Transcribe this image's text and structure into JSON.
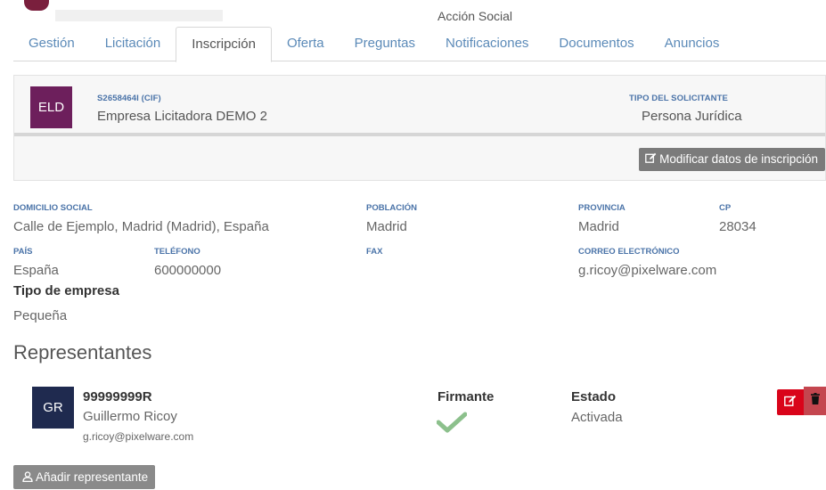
{
  "header": {
    "context_title": "Acción Social"
  },
  "tabs": [
    {
      "label": "Gestión",
      "active": false
    },
    {
      "label": "Licitación",
      "active": false
    },
    {
      "label": "Inscripción",
      "active": true
    },
    {
      "label": "Oferta",
      "active": false
    },
    {
      "label": "Preguntas",
      "active": false
    },
    {
      "label": "Notificaciones",
      "active": false
    },
    {
      "label": "Documentos",
      "active": false
    },
    {
      "label": "Anuncios",
      "active": false
    }
  ],
  "company": {
    "initials": "ELD",
    "cif": "S2658464I (CIF)",
    "name": "Empresa Licitadora DEMO 2",
    "tipo_label": "TIPO DEL SOLICITANTE",
    "tipo_value": "Persona Jurídica",
    "avatar_color": "#6d1f5c",
    "modify_label": "Modificar datos de inscripción"
  },
  "details": {
    "domicilio_label": "DOMICILIO SOCIAL",
    "domicilio_value": "Calle de Ejemplo, Madrid (Madrid), España",
    "poblacion_label": "POBLACIÓN",
    "poblacion_value": "Madrid",
    "provincia_label": "PROVINCIA",
    "provincia_value": "Madrid",
    "cp_label": "CP",
    "cp_value": "28034",
    "pais_label": "PAÍS",
    "pais_value": "España",
    "telefono_label": "TELÉFONO",
    "telefono_value": "600000000",
    "fax_label": "FAX",
    "correo_label": "CORREO ELECTRÓNICO",
    "correo_value": "g.ricoy@pixelware.com",
    "tipo_empresa_label": "Tipo de empresa",
    "tipo_empresa_value": "Pequeña"
  },
  "representantes": {
    "title": "Representantes",
    "firmante_label": "Firmante",
    "estado_label": "Estado",
    "items": [
      {
        "initials": "GR",
        "id": "99999999R",
        "name": "Guillermo Ricoy",
        "email": "g.ricoy@pixelware.com",
        "firmante_icon": "check-icon",
        "estado": "Activada"
      }
    ],
    "add_label": "Añadir representante"
  },
  "colors": {
    "link": "#5b8ab8",
    "label_blue": "#4a73a8",
    "edit_red": "#d9041a",
    "delete_red": "#c4464f",
    "check_green": "#8cc08c",
    "rep_avatar": "#1f2a4f"
  }
}
